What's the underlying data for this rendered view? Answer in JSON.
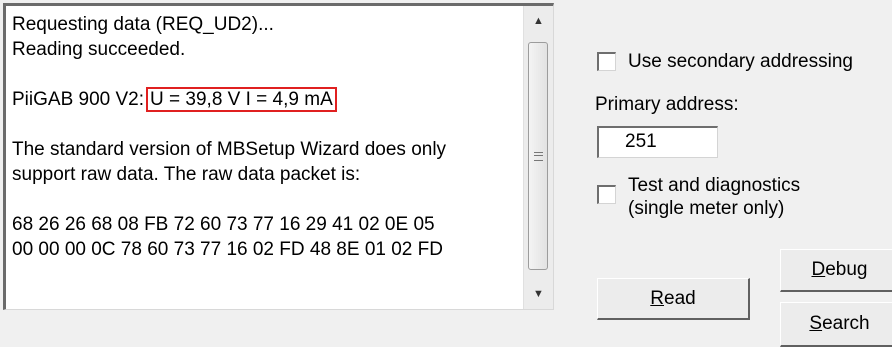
{
  "output": {
    "lines": [
      "Requesting data (REQ_UD2)...",
      "Reading succeeded.",
      "",
      "PiiGAB 900 V2:",
      "",
      "The standard version of MBSetup Wizard does only",
      "support raw data. The raw data packet is:",
      "",
      "68 26 26 68 08 FB 72 60 73 77 16 29 41 02 0E 05",
      "00 00 00 0C 78 60 73 77 16 02 FD 48 8E 01 02 FD"
    ],
    "highlight": "U = 39,8 V  I = 4,9 mA"
  },
  "options": {
    "secondary_label": "Use secondary addressing",
    "secondary_checked": false,
    "primary_label": "Primary address:",
    "primary_value": "251",
    "test_label_1": "Test and diagnostics",
    "test_label_2": "(single meter only)",
    "test_checked": false
  },
  "buttons": {
    "debug": {
      "mnemonic": "D",
      "rest": "ebug"
    },
    "read": {
      "mnemonic": "R",
      "rest": "ead"
    },
    "search": {
      "mnemonic": "S",
      "rest": "earch"
    }
  },
  "icons": {
    "scroll_up": "up-arrow-icon",
    "scroll_down": "down-arrow-icon",
    "scroll_grip": "grip-icon"
  }
}
